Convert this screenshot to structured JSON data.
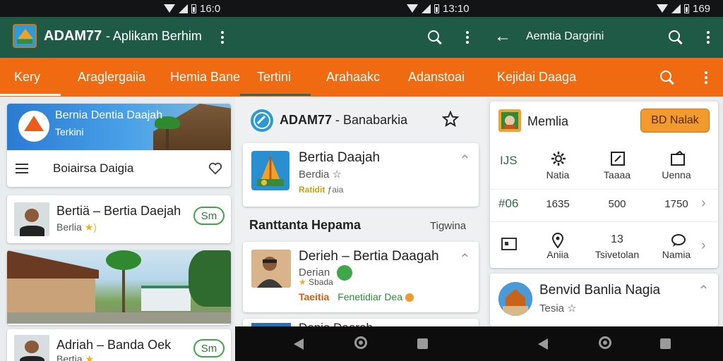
{
  "status_bar": {
    "time_1": "16:0",
    "time_2": "13:10",
    "time_3": "169"
  },
  "app_bar": {
    "brand": "ADAM77",
    "subtitle": "- Aplikam Berhim",
    "screen3_title": "Aemtia Dargrini"
  },
  "tabs": [
    {
      "label": "Kery",
      "active": true
    },
    {
      "label": "Araglergaiia",
      "active": false
    },
    {
      "label": "Hemia Bane",
      "active": false
    },
    {
      "label": "Tertini",
      "active": true
    },
    {
      "label": "Arahaakc",
      "active": false
    },
    {
      "label": "Adanstoai",
      "active": false
    },
    {
      "label": "Kejidai Daaga",
      "active": false
    }
  ],
  "panel1": {
    "banner": {
      "title": "Bernia Dentia Daajah",
      "subtitle": "Terkini"
    },
    "menu_title": "Boiairsa Daigia",
    "cards": [
      {
        "title": "Bertiä – Bertia Daejah",
        "subtitle": "Berlia",
        "badge": "Sm"
      },
      {
        "title": "Adriah – Banda Oek",
        "subtitle": "Bertia",
        "badge": "Sm"
      }
    ]
  },
  "panel2": {
    "header_title": "ADAM77",
    "header_subtitle": "- Banabarkia",
    "featured": {
      "title": "Bertia Daajah",
      "subtitle": "Berdia",
      "meta": "Ratidit",
      "meta2": "ƒaia"
    },
    "section_title": "Ranttanta Hepama",
    "section_action": "Tigwina",
    "item": {
      "title": "Derieh – Bertia Daagah",
      "subtitle": "Derian",
      "meta": "Sbada",
      "footer_1": "Taeitia",
      "footer_2": "Fenetidiar Dea"
    },
    "partial_title": "Denia Daereh"
  },
  "panel3": {
    "profile_name": "Memlia",
    "cta": "BD Nalak",
    "row1": {
      "label": "IJS",
      "cols": [
        "Natia",
        "Taaaa",
        "Uenna"
      ]
    },
    "row2": {
      "label": "#06",
      "cols": [
        "1635",
        "500",
        "1750"
      ]
    },
    "row3": {
      "cols": [
        "Aniia",
        "Tsivetolan",
        "Namia"
      ],
      "value": "13"
    },
    "news": {
      "title": "Benvid Banlia Nagia",
      "subtitle": "Tesia"
    }
  },
  "colors": {
    "status_bar": "#121416",
    "app_bar": "#1e5a45",
    "tab_bar": "#ef6a10",
    "accent_green": "#3fa64a",
    "cta_orange": "#f29a2e"
  },
  "icons": [
    "search-icon",
    "more-vert-icon",
    "back-arrow-icon",
    "star-outline-icon",
    "menu-icon",
    "heart-icon",
    "gear-icon",
    "chevron-right-icon",
    "location-icon"
  ]
}
